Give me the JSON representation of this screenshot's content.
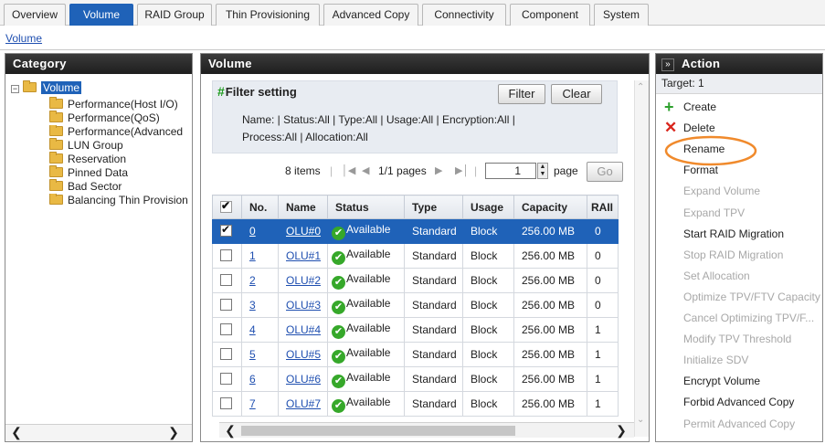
{
  "tabs": [
    {
      "label": "Overview",
      "active": false
    },
    {
      "label": "Volume",
      "active": true
    },
    {
      "label": "RAID Group",
      "active": false
    },
    {
      "label": "Thin Provisioning",
      "active": false
    },
    {
      "label": "Advanced Copy",
      "active": false
    },
    {
      "label": "Connectivity",
      "active": false
    },
    {
      "label": "Component",
      "active": false
    },
    {
      "label": "System",
      "active": false
    }
  ],
  "breadcrumb": "Volume",
  "category": {
    "title": "Category",
    "root": "Volume",
    "items": [
      "Performance(Host I/O)",
      "Performance(QoS)",
      "Performance(Advanced",
      "LUN Group",
      "Reservation",
      "Pinned Data",
      "Bad Sector",
      "Balancing Thin Provision"
    ]
  },
  "volume": {
    "title": "Volume",
    "filter_title": "Filter setting",
    "filter_button": "Filter",
    "clear_button": "Clear",
    "filter_line1": "Name:  |  Status:All  |  Type:All  |  Usage:All  |  Encryption:All  |",
    "filter_line2": "Process:All  |  Allocation:All",
    "items_count": "8 items",
    "pages": "1/1 pages",
    "page_value": "1",
    "page_label": "page",
    "go_button": "Go",
    "columns": [
      "No.",
      "Name",
      "Status",
      "Type",
      "Usage",
      "Capacity",
      "RAII"
    ],
    "rows": [
      {
        "checked": true,
        "no": "0",
        "name": "OLU#0",
        "status": "Available",
        "type": "Standard",
        "usage": "Block",
        "capacity": "256.00 MB",
        "raid": "0"
      },
      {
        "checked": false,
        "no": "1",
        "name": "OLU#1",
        "status": "Available",
        "type": "Standard",
        "usage": "Block",
        "capacity": "256.00 MB",
        "raid": "0"
      },
      {
        "checked": false,
        "no": "2",
        "name": "OLU#2",
        "status": "Available",
        "type": "Standard",
        "usage": "Block",
        "capacity": "256.00 MB",
        "raid": "0"
      },
      {
        "checked": false,
        "no": "3",
        "name": "OLU#3",
        "status": "Available",
        "type": "Standard",
        "usage": "Block",
        "capacity": "256.00 MB",
        "raid": "0"
      },
      {
        "checked": false,
        "no": "4",
        "name": "OLU#4",
        "status": "Available",
        "type": "Standard",
        "usage": "Block",
        "capacity": "256.00 MB",
        "raid": "1"
      },
      {
        "checked": false,
        "no": "5",
        "name": "OLU#5",
        "status": "Available",
        "type": "Standard",
        "usage": "Block",
        "capacity": "256.00 MB",
        "raid": "1"
      },
      {
        "checked": false,
        "no": "6",
        "name": "OLU#6",
        "status": "Available",
        "type": "Standard",
        "usage": "Block",
        "capacity": "256.00 MB",
        "raid": "1"
      },
      {
        "checked": false,
        "no": "7",
        "name": "OLU#7",
        "status": "Available",
        "type": "Standard",
        "usage": "Block",
        "capacity": "256.00 MB",
        "raid": "1"
      }
    ]
  },
  "action": {
    "title": "Action",
    "collapse_glyph": "»",
    "target": "Target: 1",
    "items": [
      {
        "label": "Create",
        "enabled": true,
        "icon": "plus-icon"
      },
      {
        "label": "Delete",
        "enabled": true,
        "icon": "x-icon"
      },
      {
        "label": "Rename",
        "enabled": true
      },
      {
        "label": "Format",
        "enabled": true
      },
      {
        "label": "Expand Volume",
        "enabled": false
      },
      {
        "label": "Expand TPV",
        "enabled": false
      },
      {
        "label": "Start RAID Migration",
        "enabled": true
      },
      {
        "label": "Stop RAID Migration",
        "enabled": false
      },
      {
        "label": "Set Allocation",
        "enabled": false
      },
      {
        "label": "Optimize TPV/FTV Capacity",
        "enabled": false
      },
      {
        "label": "Cancel Optimizing TPV/F...",
        "enabled": false
      },
      {
        "label": "Modify TPV Threshold",
        "enabled": false
      },
      {
        "label": "Initialize SDV",
        "enabled": false
      },
      {
        "label": "Encrypt Volume",
        "enabled": true
      },
      {
        "label": "Forbid Advanced Copy",
        "enabled": true
      },
      {
        "label": "Permit Advanced Copy",
        "enabled": false
      }
    ]
  },
  "colors": {
    "tab_active": "#1f62b8",
    "row_selected": "#1f62b8",
    "highlight_circle": "#f08a2c",
    "available_icon": "#36a82a"
  }
}
